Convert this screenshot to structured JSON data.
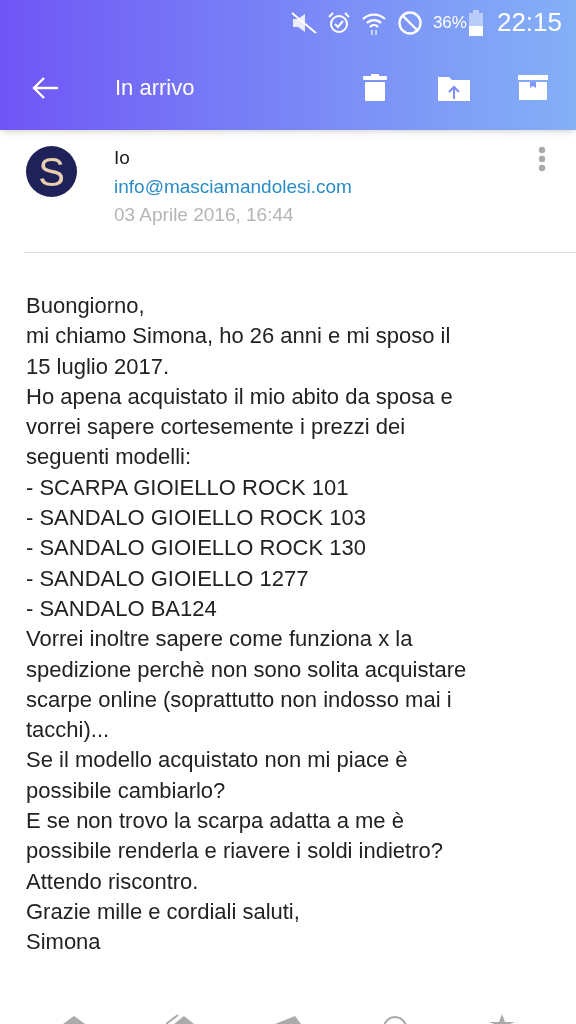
{
  "status_bar": {
    "battery": "36%",
    "time": "22:15"
  },
  "toolbar": {
    "title": "In arrivo"
  },
  "message": {
    "avatar_letter": "S",
    "sender": "Io",
    "address": "info@masciamandolesi.com",
    "date": "03 Aprile 2016, 16:44",
    "body_lines": [
      "Buongiorno,",
      "mi chiamo Simona, ho 26 anni e mi sposo il",
      "15 luglio 2017.",
      "Ho apena acquistato il mio abito da sposa e",
      "vorrei sapere cortesemente i prezzi dei",
      "seguenti modelli:",
      "- SCARPA GIOIELLO ROCK 101",
      "- SANDALO GIOIELLO ROCK 103",
      "- SANDALO GIOIELLO ROCK 130",
      "- SANDALO GIOIELLO 1277",
      "- SANDALO BA124",
      "Vorrei inoltre sapere come funziona x la",
      "spedizione perchè non sono solita acquistare",
      "scarpe online (soprattutto non indosso mai i",
      "tacchi)...",
      "Se il modello acquistato non mi piace è",
      "possibile cambiarlo?",
      "E se non trovo la scarpa adatta a me è",
      "possibile renderla e riavere i soldi indietro?",
      "Attendo riscontro.",
      "Grazie mille e cordiali saluti,",
      "Simona"
    ]
  }
}
